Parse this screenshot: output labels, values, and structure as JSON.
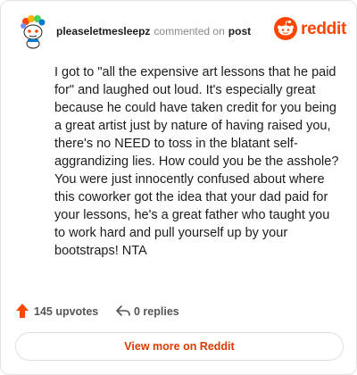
{
  "header": {
    "username": "pleaseletmesleepz",
    "action_text": "commented on",
    "target_text": "post",
    "brand_text": "reddit"
  },
  "comment": {
    "body": "I got to \"all the expensive art lessons that he paid for\" and laughed out loud. It's especially great because he could have taken credit for you being a great artist just by nature of having raised you, there's no NEED to toss in the blatant self-aggrandizing lies. How could you be the asshole? You were just innocently confused about where this coworker got the idea that your dad paid for your lessons, he's a great father who taught you to work hard and pull yourself up by your bootstraps! NTA"
  },
  "stats": {
    "upvotes": "145 upvotes",
    "replies": "0 replies"
  },
  "footer": {
    "view_more_label": "View more on Reddit"
  },
  "icons": {
    "avatar": "snoo-avatar-icon",
    "brand": "reddit-logo-icon",
    "upvote": "upvote-arrow-icon",
    "reply": "reply-arrow-icon"
  },
  "colors": {
    "accent": "#ff4500",
    "link": "#d93a00",
    "upvote": "#ff4500"
  }
}
